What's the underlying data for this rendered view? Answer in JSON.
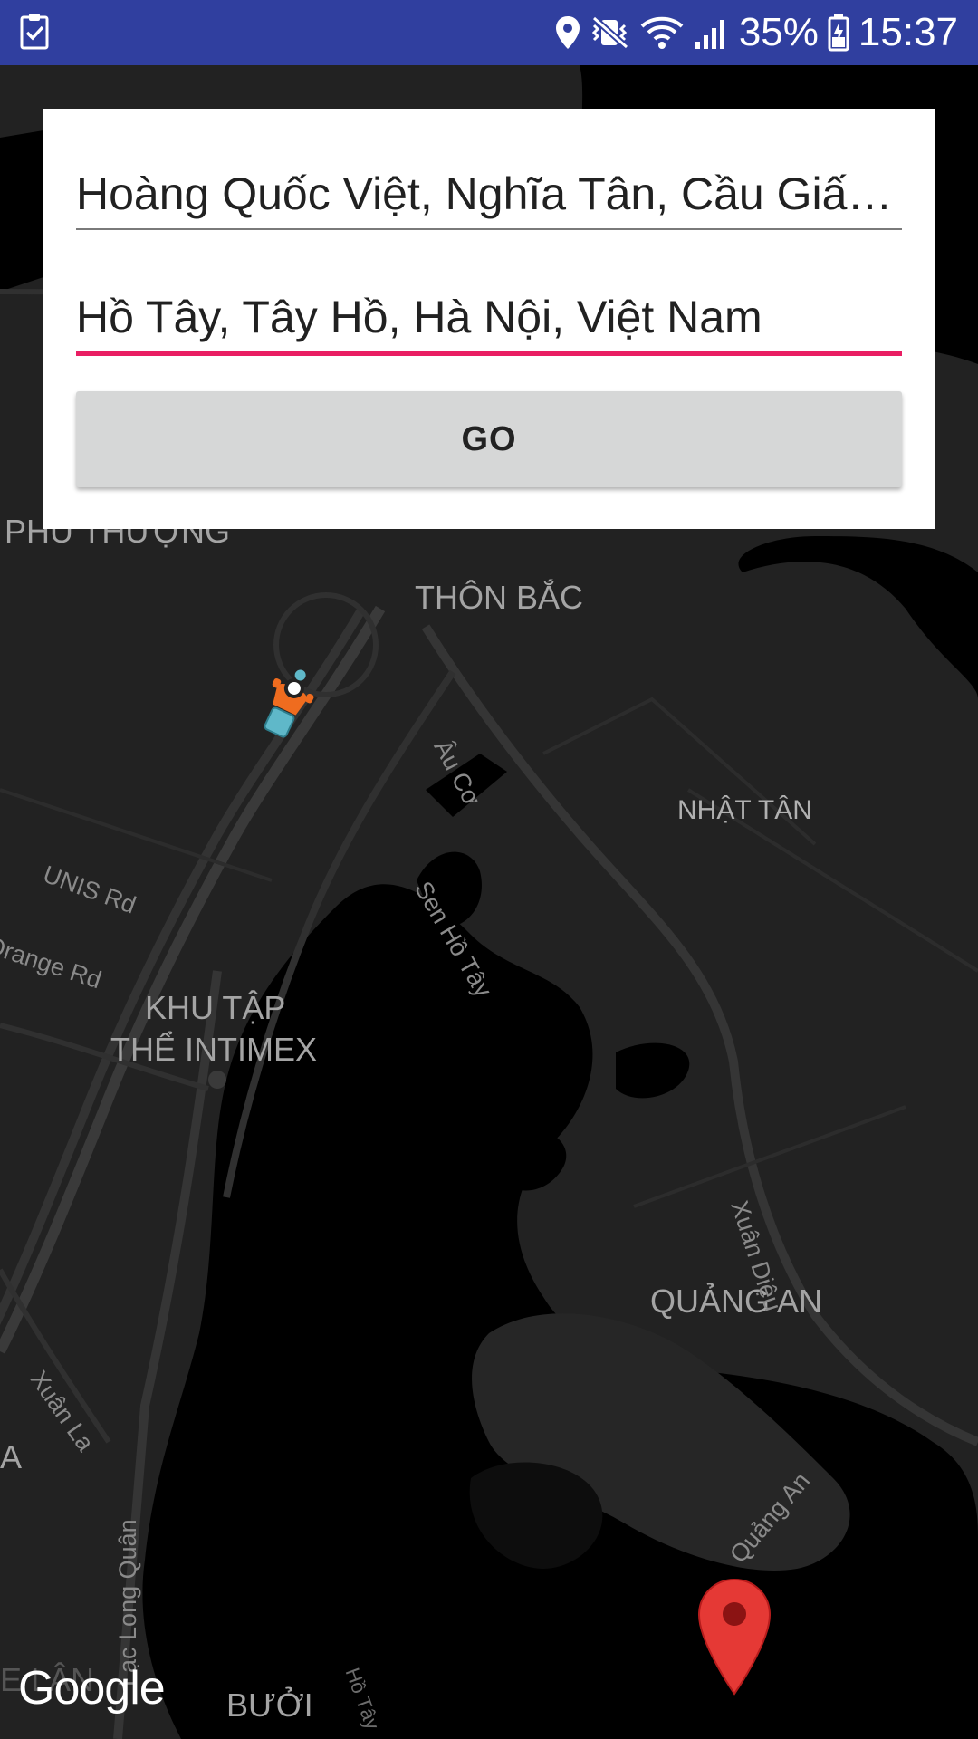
{
  "status_bar": {
    "left_icon": "clipboard-check-icon",
    "icons": [
      "location-pin-icon",
      "vibrate-mute-icon",
      "wifi-icon",
      "signal-icon",
      "battery-icon"
    ],
    "battery_percent": "35%",
    "time": "15:37",
    "background_color": "#303f9f"
  },
  "route_form": {
    "origin_value": "Hoàng Quốc Việt, Nghĩa Tân, Cầu Giấy, Hà Nội, Việt Nam",
    "destination_value": "Hồ Tây, Tây Hồ, Hà Nội, Việt Nam",
    "go_label": "GO",
    "focus_color": "#e91e63"
  },
  "map": {
    "style": "dark",
    "area_labels": {
      "phu_thuong": "PHÚ THƯỢNG",
      "thon_bac": "THÔN BẮC",
      "nhat_tan": "NHẬT TÂN",
      "khu_tap_line1": "KHU TẬP",
      "khu_tap_line2": "THỂ INTIMEX",
      "quang_an": "QUẢNG AN",
      "buoi": "BƯỞI",
      "edge_a": "A",
      "edge_bottom_left": "E LÂN"
    },
    "road_labels": {
      "au_co": "Âu Cơ",
      "unis_rd": "UNIS Rd",
      "orange_rd": "Orange Rd",
      "sen_ho_tay": "Sen Hồ Tây",
      "xuan_dieu": "Xuân Diệu",
      "xuan_la": "Xuân La",
      "lac_long_quan": "Lạc Long Quân",
      "quang_an_rd": "Quảng An",
      "ho_tay": "Hồ Tây"
    },
    "attribution": "Google",
    "markers": [
      "delivery-rider-icon",
      "destination-pin-icon"
    ]
  }
}
